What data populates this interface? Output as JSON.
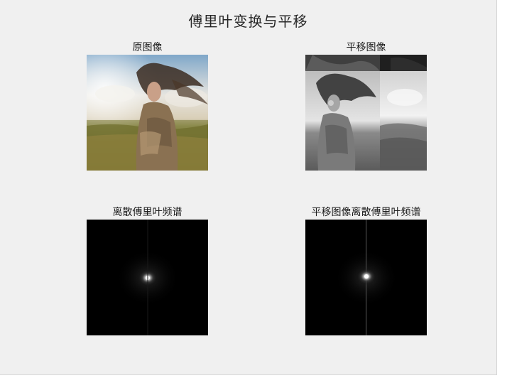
{
  "figure": {
    "title": "傅里叶变换与平移"
  },
  "subplots": [
    {
      "title": "原图像",
      "content": "color photo of a woman with windblown hair in a grassy field"
    },
    {
      "title": "平移图像",
      "content": "grayscale photo, circularly shifted, quadrants swapped"
    },
    {
      "title": "离散傅里叶频谱",
      "content": "dark spectrum with bright spot at center"
    },
    {
      "title": "平移图像离散傅里叶频谱",
      "content": "dark spectrum with bright spot at center and faint vertical line"
    }
  ],
  "colors": {
    "figure_background": "#f0f0f0",
    "spectrum_background": "#000000",
    "spectrum_peak": "#ffffff"
  }
}
